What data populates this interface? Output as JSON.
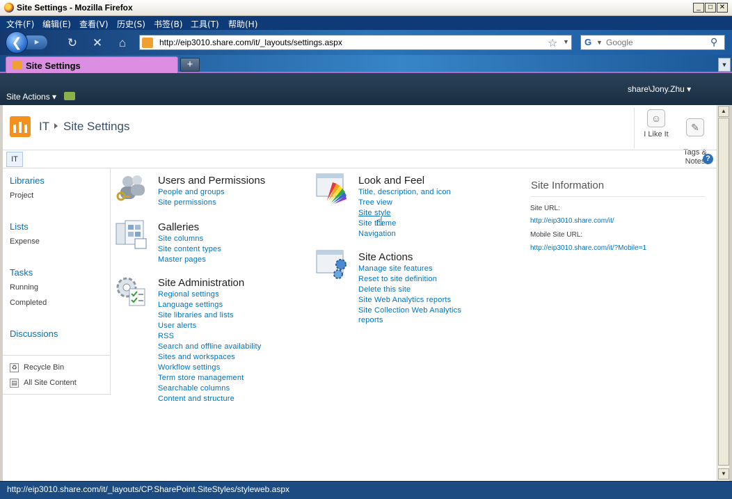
{
  "window": {
    "title": "Site Settings - Mozilla Firefox"
  },
  "menu": [
    "文件(F)",
    "编辑(E)",
    "查看(V)",
    "历史(S)",
    "书签(B)",
    "工具(T)",
    "帮助(H)"
  ],
  "navbar": {
    "url": "http://eip3010.share.com/it/_layouts/settings.aspx",
    "search_placeholder": "Google"
  },
  "tabs": [
    {
      "label": "Site Settings"
    }
  ],
  "sp_header": {
    "site_actions": "Site Actions",
    "user": "share\\Jony.Zhu"
  },
  "breadcrumb": {
    "site": "IT",
    "page": "Site Settings"
  },
  "toolbar": {
    "like": "I Like It",
    "tags": "Tags &\nNotes"
  },
  "tabline": {
    "tab": "IT",
    "help": "?"
  },
  "leftnav": {
    "libraries": {
      "label": "Libraries",
      "items": [
        "Project"
      ]
    },
    "lists": {
      "label": "Lists",
      "items": [
        "Expense"
      ]
    },
    "tasks": {
      "label": "Tasks",
      "items": [
        "Running",
        "Completed"
      ]
    },
    "discussions": {
      "label": "Discussions"
    },
    "recycle_bin": "Recycle Bin",
    "all_content": "All Site Content"
  },
  "sections": {
    "users": {
      "title": "Users and Permissions",
      "links": [
        "People and groups",
        "Site permissions"
      ]
    },
    "galleries": {
      "title": "Galleries",
      "links": [
        "Site columns",
        "Site content types",
        "Master pages"
      ]
    },
    "admin": {
      "title": "Site Administration",
      "links": [
        "Regional settings",
        "Language settings",
        "Site libraries and lists",
        "User alerts",
        "RSS",
        "Search and offline availability",
        "Sites and workspaces",
        "Workflow settings",
        "Term store management",
        "Searchable columns",
        "Content and structure"
      ]
    },
    "look": {
      "title": "Look and Feel",
      "links": [
        "Title, description, and icon",
        "Tree view",
        "Site style",
        "Site theme",
        "Navigation"
      ]
    },
    "actions": {
      "title": "Site Actions",
      "links": [
        "Manage site features",
        "Reset to site definition",
        "Delete this site",
        "Site Web Analytics reports",
        "Site Collection Web Analytics",
        "reports"
      ]
    }
  },
  "site_info": {
    "title": "Site Information",
    "url_label": "Site URL:",
    "url": "http://eip3010.share.com/it/",
    "mobile_label": "Mobile Site URL:",
    "mobile_url": "http://eip3010.share.com/it/?Mobile=1"
  },
  "status": "http://eip3010.share.com/it/_layouts/CP.SharePoint.SiteStyles/styleweb.aspx"
}
